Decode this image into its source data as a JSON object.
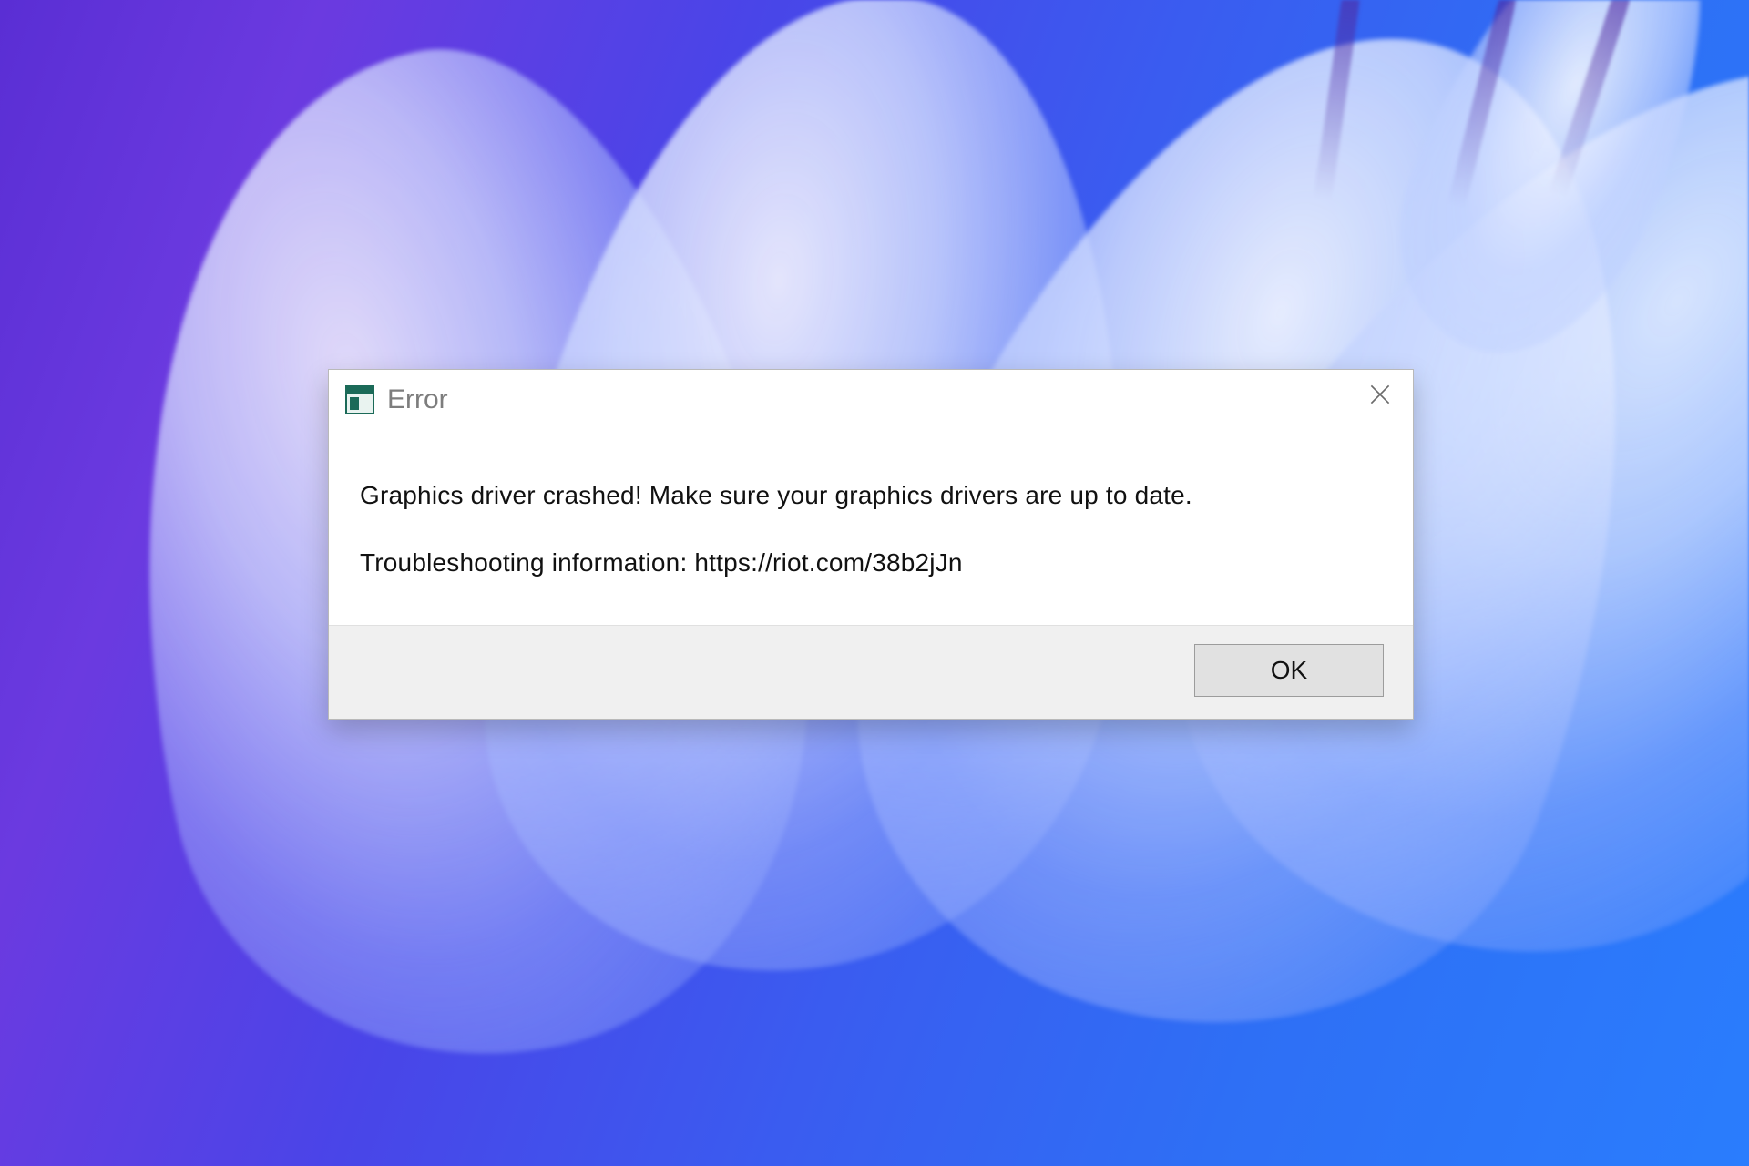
{
  "dialog": {
    "title": "Error",
    "message_line1": "Graphics driver crashed! Make sure your graphics drivers are up to date.",
    "message_line2": "Troubleshooting information: https://riot.com/38b2jJn",
    "ok_label": "OK"
  }
}
